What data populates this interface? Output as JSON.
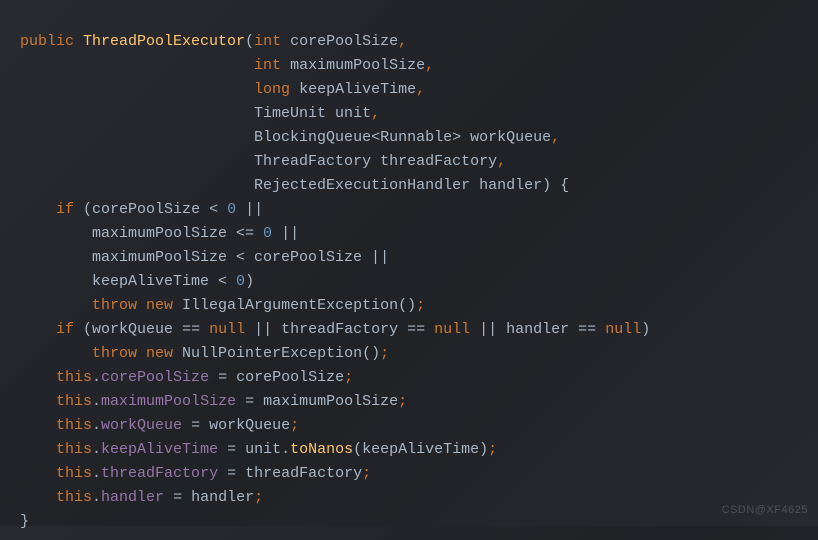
{
  "code": {
    "l1": {
      "kw_public": "public",
      "name": "ThreadPoolExecutor",
      "lp": "(",
      "kw_int1": "int",
      "p1": " corePoolSize",
      "c": ","
    },
    "l2": {
      "pad": "                          ",
      "kw_int": "int",
      "p": " maximumPoolSize",
      "c": ","
    },
    "l3": {
      "pad": "                          ",
      "kw_long": "long",
      "p": " keepAliveTime",
      "c": ","
    },
    "l4": {
      "pad": "                          ",
      "t": "TimeUnit unit",
      "c": ","
    },
    "l5": {
      "pad": "                          ",
      "t1": "BlockingQueue<Runnable> workQueue",
      "c": ","
    },
    "l6": {
      "pad": "                          ",
      "t": "ThreadFactory threadFactory",
      "c": ","
    },
    "l7": {
      "pad": "                          ",
      "t": "RejectedExecutionHandler handler",
      "rp": ") {"
    },
    "l8": {
      "pad": "    ",
      "kw_if": "if",
      "lp": " (",
      "v": "corePoolSize < ",
      "n": "0",
      "or": " ||"
    },
    "l9": {
      "pad": "        ",
      "v": "maximumPoolSize <= ",
      "n": "0",
      "or": " ||"
    },
    "l10": {
      "pad": "        ",
      "v": "maximumPoolSize < corePoolSize ||"
    },
    "l11": {
      "pad": "        ",
      "v": "keepAliveTime < ",
      "n": "0",
      "rp": ")"
    },
    "l12": {
      "pad": "        ",
      "kw_throw": "throw",
      "kw_new": " new",
      "ex": " IllegalArgumentException",
      "call": "()",
      "sc": ";"
    },
    "l13": {
      "pad": "    ",
      "kw_if": "if",
      "lp": " (",
      "v1": "workQueue == ",
      "n1": "null",
      "or1": " || ",
      "v2": "threadFactory == ",
      "n2": "null",
      "or2": " || ",
      "v3": "handler == ",
      "n3": "null",
      "rp": ")"
    },
    "l14": {
      "pad": "        ",
      "kw_throw": "throw",
      "kw_new": " new",
      "ex": " NullPointerException",
      "call": "()",
      "sc": ";"
    },
    "l15": {
      "pad": "    ",
      "kw_this": "this",
      "dot": ".",
      "f": "corePoolSize",
      "eq": " = corePoolSize",
      "sc": ";"
    },
    "l16": {
      "pad": "    ",
      "kw_this": "this",
      "dot": ".",
      "f": "maximumPoolSize",
      "eq": " = maximumPoolSize",
      "sc": ";"
    },
    "l17": {
      "pad": "    ",
      "kw_this": "this",
      "dot": ".",
      "f": "workQueue",
      "eq": " = workQueue",
      "sc": ";"
    },
    "l18": {
      "pad": "    ",
      "kw_this": "this",
      "dot": ".",
      "f": "keepAliveTime",
      "eq": " = unit.",
      "m": "toNanos",
      "args": "(keepAliveTime)",
      "sc": ";"
    },
    "l19": {
      "pad": "    ",
      "kw_this": "this",
      "dot": ".",
      "f": "threadFactory",
      "eq": " = threadFactory",
      "sc": ";"
    },
    "l20": {
      "pad": "    ",
      "kw_this": "this",
      "dot": ".",
      "f": "handler",
      "eq": " = handler",
      "sc": ";"
    },
    "l21": {
      "brace": "}"
    }
  },
  "watermark": "CSDN@XF4625"
}
